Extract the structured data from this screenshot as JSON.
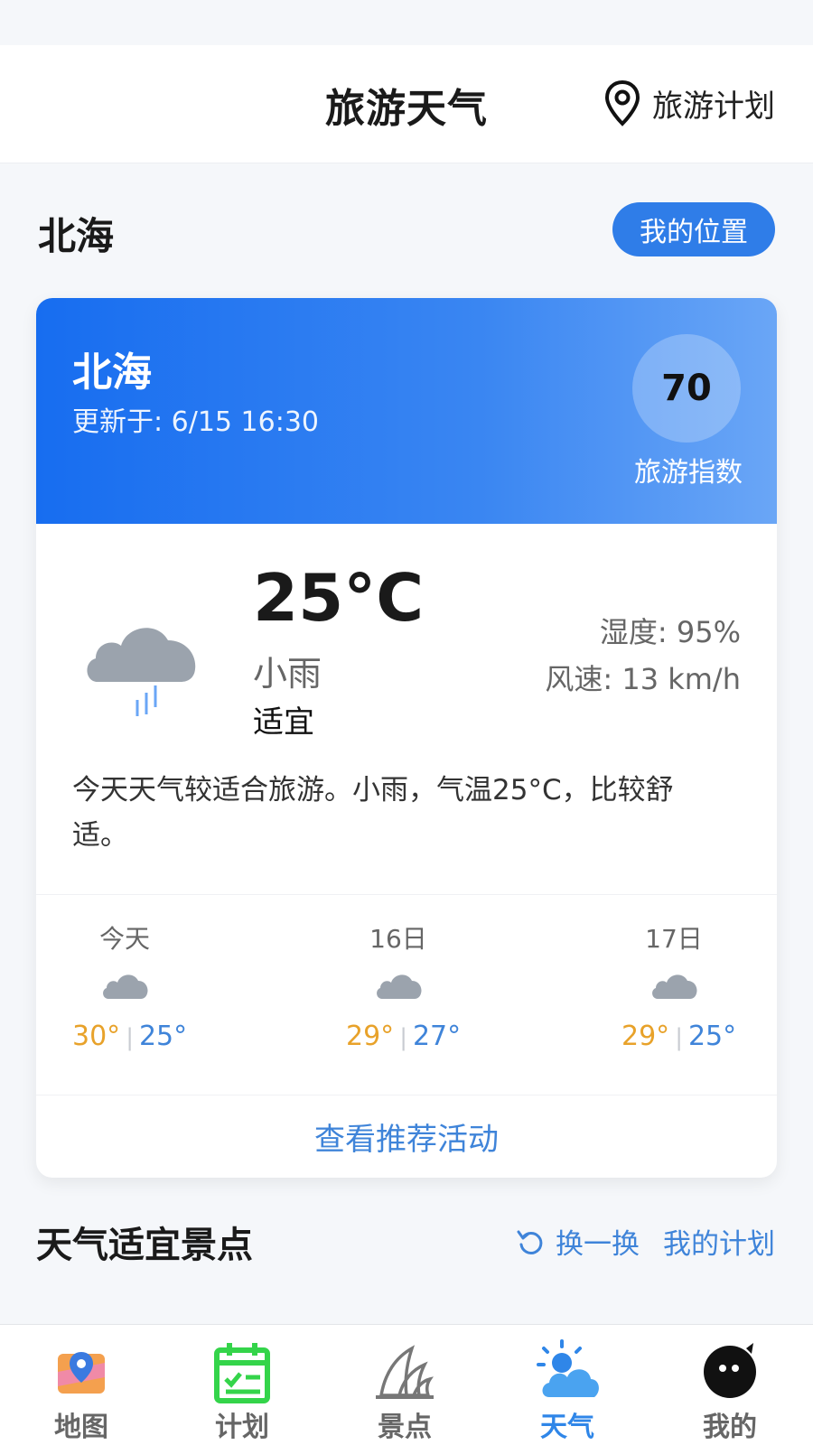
{
  "header": {
    "title": "旅游天气",
    "plan_label": "旅游计划"
  },
  "location": {
    "city": "北海",
    "my_location_label": "我的位置"
  },
  "weather_card": {
    "city": "北海",
    "updated": "更新于: 6/15 16:30",
    "travel_index": "70",
    "travel_index_label": "旅游指数",
    "temperature": "25°C",
    "condition": "小雨",
    "suitability": "适宜",
    "humidity": "湿度: 95%",
    "wind": "风速: 13 km/h",
    "description": "今天天气较适合旅游。小雨，气温25°C，比较舒适。",
    "forecast": [
      {
        "day": "今天",
        "high": "30°",
        "low": "25°",
        "icon": "cloud-icon"
      },
      {
        "day": "16日",
        "high": "29°",
        "low": "27°",
        "icon": "cloud-icon"
      },
      {
        "day": "17日",
        "high": "29°",
        "low": "25°",
        "icon": "cloud-icon"
      }
    ],
    "activity_link": "查看推荐活动",
    "colors": {
      "header_gradient_start": "#176df0",
      "header_gradient_end": "#6aa6f6",
      "high_temp": "#e8a22a",
      "low_temp": "#3f84d9"
    }
  },
  "recommend": {
    "title": "天气适宜景点",
    "refresh_label": "换一换",
    "my_plan_label": "我的计划"
  },
  "tabbar": {
    "items": [
      {
        "label": "地图",
        "icon": "map-icon"
      },
      {
        "label": "计划",
        "icon": "calendar-icon"
      },
      {
        "label": "景点",
        "icon": "opera-house-icon"
      },
      {
        "label": "天气",
        "icon": "weather-icon"
      },
      {
        "label": "我的",
        "icon": "profile-icon"
      }
    ],
    "active": "天气",
    "active_color": "#2f86e8"
  }
}
